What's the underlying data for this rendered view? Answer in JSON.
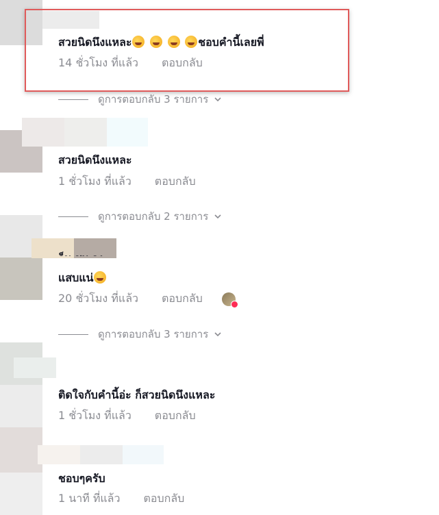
{
  "comments": [
    {
      "text": "สวยนิดนึงแหละ",
      "text_suffix": "ชอบคำนี้เลยพี่",
      "time": "14 ชั่วโมง ที่แล้ว",
      "reply": "ตอบกลับ"
    },
    {
      "text": "สวยนิดนึงแหละ",
      "time": "1 ชั่วโมง ที่แล้ว",
      "reply": "ตอบกลับ"
    },
    {
      "name_partial": "ก็ม ชม จุง",
      "text": "แสบแน่",
      "time": "20 ชั่วโมง ที่แล้ว",
      "reply": "ตอบกลับ"
    },
    {
      "text": "ติดใจกับคำนี้อ่ะ ก็สวยนิดนึงแหละ",
      "time": "1 ชั่วโมง ที่แล้ว",
      "reply": "ตอบกลับ"
    },
    {
      "text": "ชอบๆครับ",
      "time": "1 นาที ที่แล้ว",
      "reply": "ตอบกลับ"
    }
  ],
  "view_replies": [
    "ดูการตอบกลับ 3 รายการ",
    "ดูการตอบกลับ 2 รายการ",
    "ดูการตอบกลับ 3 รายการ"
  ],
  "colors": {
    "highlight": "#e05a5a",
    "muted": "#8a8b91",
    "text": "#161823",
    "like_heart": "#fe2c55"
  }
}
